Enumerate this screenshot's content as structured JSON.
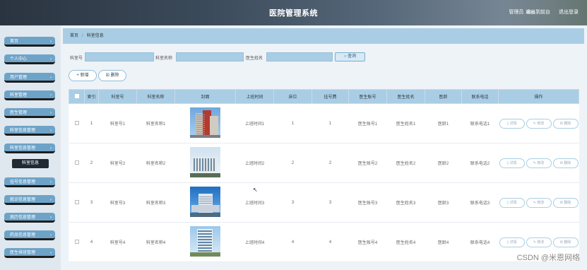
{
  "header": {
    "title": "医院管理系统",
    "user_label": "管理员",
    "username": "abo",
    "back_label": "退出到前台",
    "logout_label": "退出登录"
  },
  "sidebar": {
    "items": [
      {
        "label": "首页"
      },
      {
        "label": "个人中心"
      },
      {
        "label": "用户管理"
      },
      {
        "label": "科室管理"
      },
      {
        "label": "医生管理"
      },
      {
        "label": "科室信息管理"
      },
      {
        "label": "科室信息管理"
      },
      {
        "label": "挂号信息管理"
      },
      {
        "label": "就诊信息管理"
      },
      {
        "label": "病历信息管理"
      },
      {
        "label": "药品信息管理"
      },
      {
        "label": "医生排班管理"
      }
    ],
    "active_sub": "科室信息"
  },
  "breadcrumb": {
    "home": "首页",
    "current": "科室信息"
  },
  "search": {
    "field1_label": "科室号",
    "field2_label": "科室名称",
    "field3_label": "医生姓名",
    "button_label": "查询"
  },
  "actions": {
    "add_label": "新增",
    "delete_label": "删除"
  },
  "table": {
    "headers": [
      "索引",
      "科室号",
      "科室名称",
      "封面",
      "上班时间",
      "床位",
      "挂号费",
      "医生账号",
      "医生姓名",
      "医龄",
      "联系电话",
      "操作"
    ],
    "rows": [
      {
        "index": "1",
        "dept_no": "科室号1",
        "dept_name": "科室名称1",
        "work_time": "上班时间1",
        "beds": "1",
        "fee": "1",
        "doctor_account": "医生账号1",
        "doctor_name": "医生姓名1",
        "age": "医龄1",
        "phone": "联系电话1"
      },
      {
        "index": "2",
        "dept_no": "科室号2",
        "dept_name": "科室名称2",
        "work_time": "上班时间2",
        "beds": "2",
        "fee": "2",
        "doctor_account": "医生账号2",
        "doctor_name": "医生姓名2",
        "age": "医龄2",
        "phone": "联系电话2"
      },
      {
        "index": "3",
        "dept_no": "科室号3",
        "dept_name": "科室名称3",
        "work_time": "上班时间3",
        "beds": "3",
        "fee": "3",
        "doctor_account": "医生账号3",
        "doctor_name": "医生姓名3",
        "age": "医龄3",
        "phone": "联系电话3"
      },
      {
        "index": "4",
        "dept_no": "科室号4",
        "dept_name": "科室名称4",
        "work_time": "上班时间4",
        "beds": "4",
        "fee": "4",
        "doctor_account": "医生账号4",
        "doctor_name": "医生姓名4",
        "age": "医龄4",
        "phone": "联系电话4"
      }
    ],
    "op_detail": "详情",
    "op_edit": "修改",
    "op_delete": "删除"
  },
  "watermark": "CSDN @米恩网络",
  "colors": {
    "accent": "#a9cde4",
    "sidebar_item": "#6ea3c8",
    "topbar": "#3b4a5a"
  }
}
